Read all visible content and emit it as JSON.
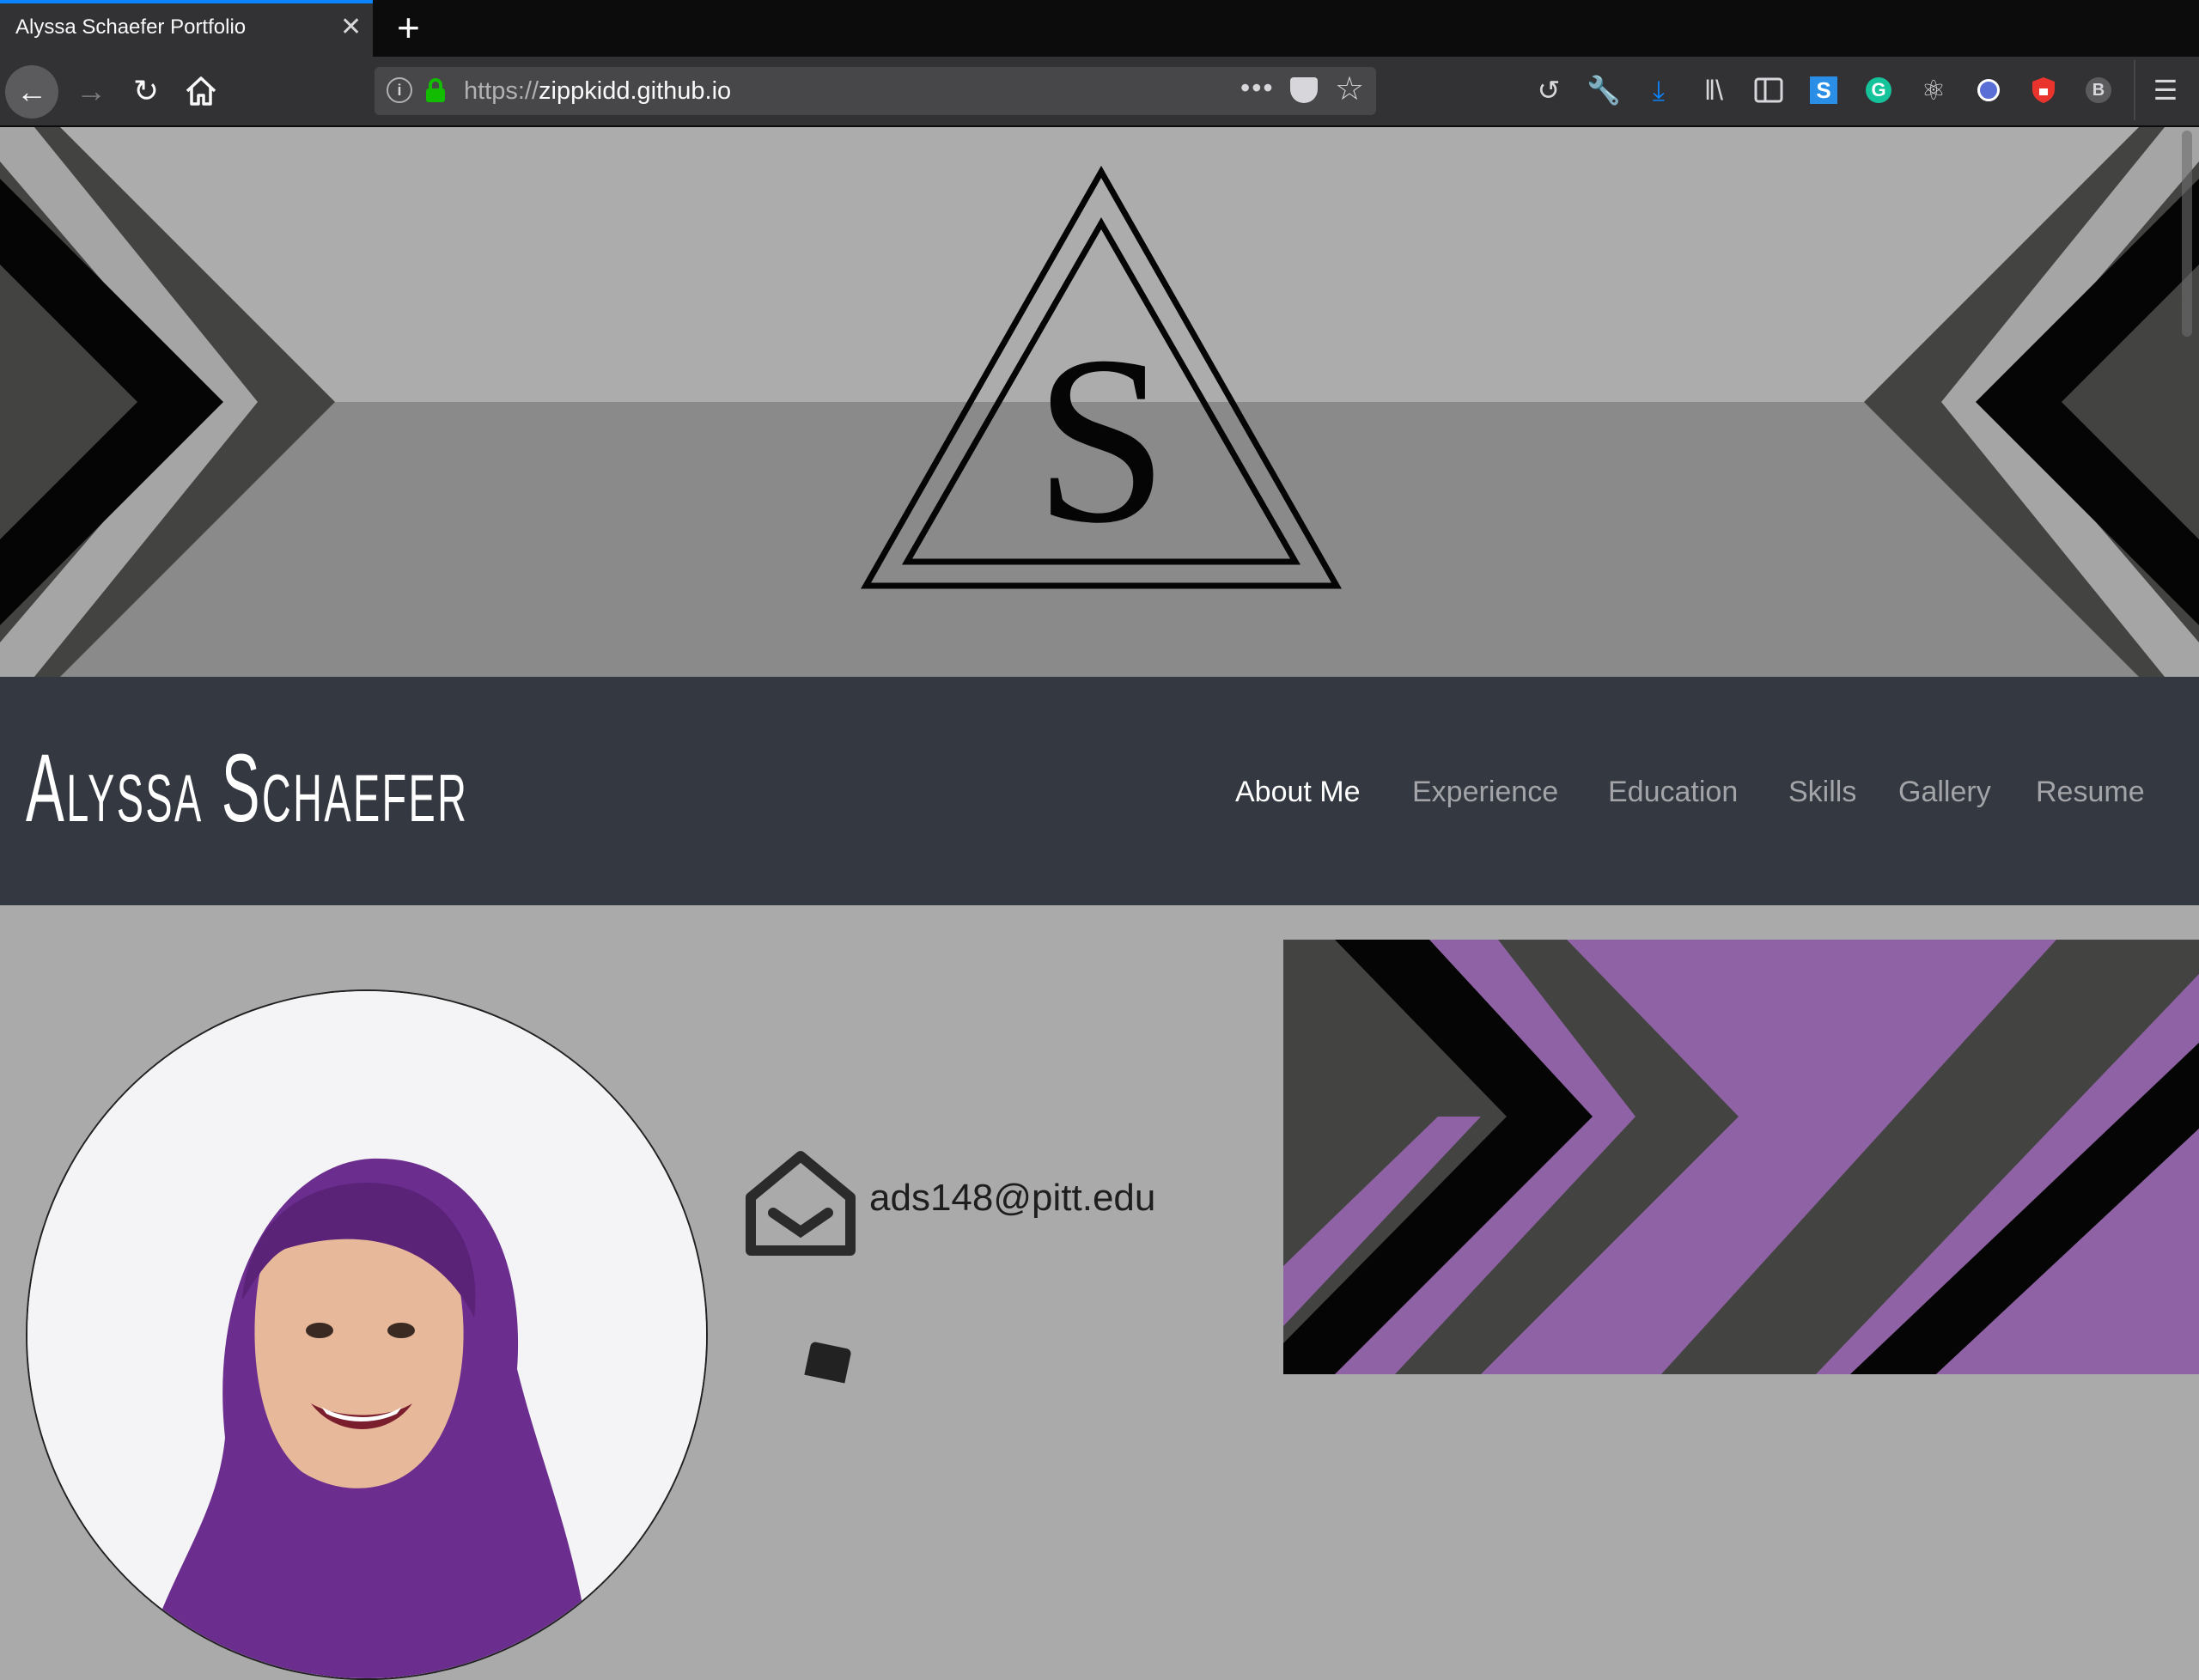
{
  "browser": {
    "tab_title": "Alyssa Schaefer Portfolio",
    "tab_close": "✕",
    "new_tab": "+",
    "url_protocol": "https://",
    "url_host": "zippkidd.github.io",
    "url_more": "•••",
    "accent_color": "#0a84ff",
    "lock_color": "#12bc00",
    "toolbar_icons": [
      "history-icon",
      "wrench-icon",
      "download-icon",
      "library-icon",
      "sidebar-icon",
      "s-extension-icon",
      "grammarly-icon",
      "react-devtools-icon",
      "block-icon",
      "shield-icon",
      "b-extension-icon",
      "menu-icon"
    ]
  },
  "site": {
    "logo_letter": "S",
    "name": "Alyssa Schaefer",
    "nav": [
      {
        "label": "About Me"
      },
      {
        "label": "Experience"
      },
      {
        "label": "Education"
      },
      {
        "label": "Skills"
      },
      {
        "label": "Gallery"
      },
      {
        "label": "Resume"
      }
    ],
    "email": "ads148@pitt.edu",
    "header_color": "#343841",
    "accent_purple": "#8e62a4"
  }
}
